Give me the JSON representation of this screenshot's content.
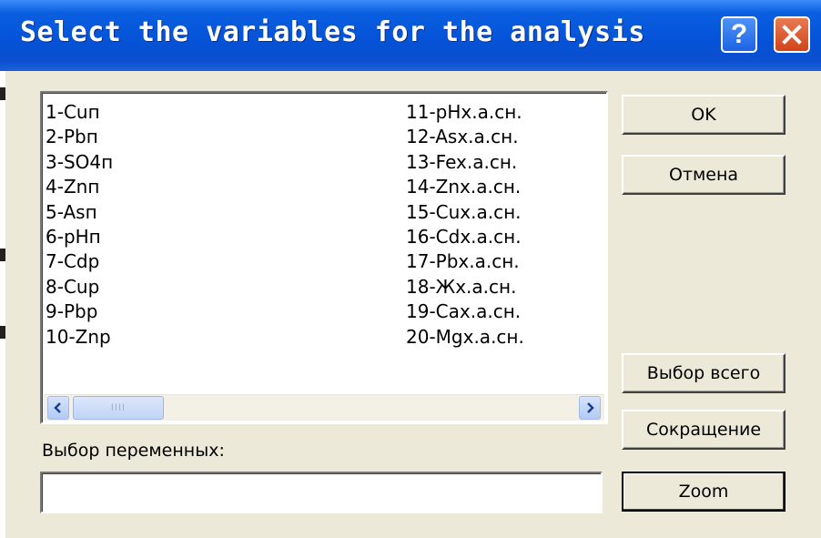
{
  "window": {
    "title": "Select the variables for the analysis",
    "help_label": "?",
    "close_icon": "close-icon"
  },
  "variable_list": {
    "items": [
      "1-Cuп",
      "2-Pbп",
      "3-SO4п",
      "4-Znп",
      "5-Asп",
      "6-pHп",
      "7-Cdp",
      "8-Cup",
      "9-Pbp",
      "10-Znp",
      "11-pHx.a.сн.",
      "12-Asx.a.сн.",
      "13-Fex.a.сн.",
      "14-Znx.a.сн.",
      "15-Cux.a.сн.",
      "16-Cdx.a.сн.",
      "17-Pbx.a.сн.",
      "18-Жx.a.сн.",
      "19-Cax.a.сн.",
      "20-Mgx.a.сн."
    ]
  },
  "scrollbar": {
    "left_icon": "scroll-left-icon",
    "right_icon": "scroll-right-icon",
    "thumb_grip": "IIII"
  },
  "selection": {
    "label": "Выбор переменных:",
    "value": ""
  },
  "buttons": {
    "ok": "OK",
    "cancel": "Отмена",
    "select_all": "Выбор всего",
    "abbreviation": "Сокращение",
    "zoom": "Zoom"
  },
  "colors": {
    "titlebar": "#0553d8",
    "dialog_bg": "#ece9d8",
    "close_button": "#d1431a"
  }
}
